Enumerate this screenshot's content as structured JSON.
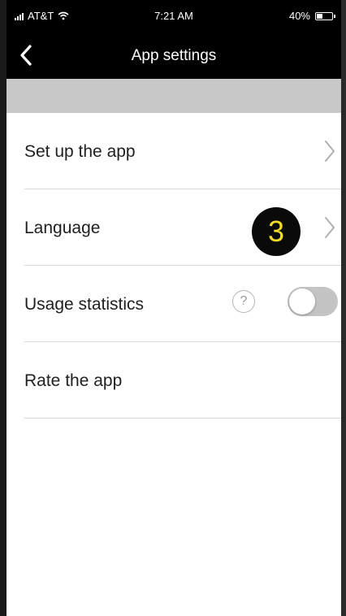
{
  "status_bar": {
    "carrier": "AT&T",
    "time": "7:21 AM",
    "battery_percent": "40%",
    "battery_level": 0.4,
    "icons": [
      "signal-icon",
      "wifi-icon",
      "battery-icon"
    ]
  },
  "nav": {
    "title": "App settings",
    "back_icon": "chevron-left-icon"
  },
  "settings": {
    "items": [
      {
        "label": "Set up the app",
        "accessory": "chevron-right-icon"
      },
      {
        "label": "Language",
        "accessory": "chevron-right-icon",
        "badge": "3"
      },
      {
        "label": "Usage statistics",
        "help_icon": "?",
        "toggle_on": false
      },
      {
        "label": "Rate the app"
      }
    ]
  },
  "colors": {
    "nav_background": "#000000",
    "section_header": "#c8c8c8",
    "badge_background": "#0a0a0a",
    "badge_text": "#f2dc2a",
    "toggle_off": "#c4c4c4",
    "divider": "#d9d9d9"
  }
}
